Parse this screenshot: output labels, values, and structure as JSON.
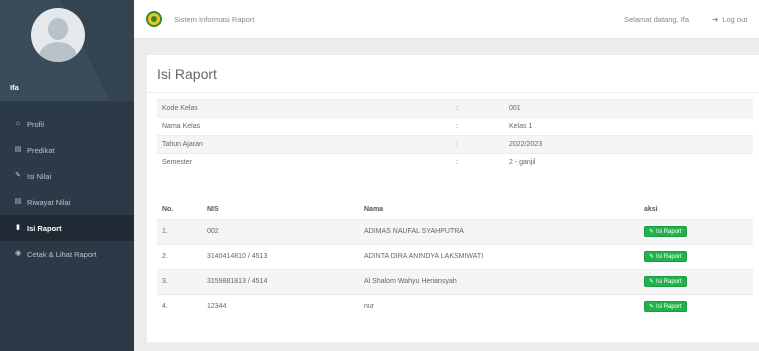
{
  "app": {
    "title": "Sistem Informasi Raport"
  },
  "header": {
    "greeting": "Selamat datang, Ifa",
    "logout_label": "Log out",
    "logout_icon": "logout-icon"
  },
  "sidebar": {
    "user_name": "Ifa",
    "items": [
      {
        "label": "Profil",
        "icon": "home-icon",
        "active": false
      },
      {
        "label": "Predikat",
        "icon": "table-icon",
        "active": false
      },
      {
        "label": "Isi Nilai",
        "icon": "pencil-icon",
        "active": false
      },
      {
        "label": "Riwayat Nilai",
        "icon": "table-icon",
        "active": false
      },
      {
        "label": "Isi Raport",
        "icon": "book-icon",
        "active": true
      },
      {
        "label": "Cetak & Lihat Raport",
        "icon": "eye-icon",
        "active": false
      }
    ]
  },
  "page": {
    "title": "Isi Raport"
  },
  "info": {
    "separator": ":",
    "rows": [
      {
        "label": "Kode Kelas",
        "value": "001"
      },
      {
        "label": "Nama Kelas",
        "value": "Kelas 1"
      },
      {
        "label": "Tahun Ajaran",
        "value": "2022/2023"
      },
      {
        "label": "Semester",
        "value": "2 - ganjil"
      }
    ]
  },
  "students": {
    "headers": {
      "no": "No.",
      "nis": "NIS",
      "nama": "Nama",
      "aksi": "aksi"
    },
    "button_label": "Isi Raport",
    "rows": [
      {
        "no": "1.",
        "nis": "002",
        "nama": "ADIMAS NAUFAL SYAHPUTRA"
      },
      {
        "no": "2.",
        "nis": "3140414810 / 4513",
        "nama": "ADINTA DIRA ANINDYA LAKSMIWATI"
      },
      {
        "no": "3.",
        "nis": "3159881813 / 4514",
        "nama": "Al Shalom Wahyu Heriansyah"
      },
      {
        "no": "4.",
        "nis": "12344",
        "nama": "nur"
      }
    ]
  },
  "colors": {
    "sidebar": "#2c3a48",
    "active": "#1f2a35",
    "button": "#22b24c",
    "logo_yellow": "#f3c51a",
    "logo_green": "#2e8b3a"
  }
}
